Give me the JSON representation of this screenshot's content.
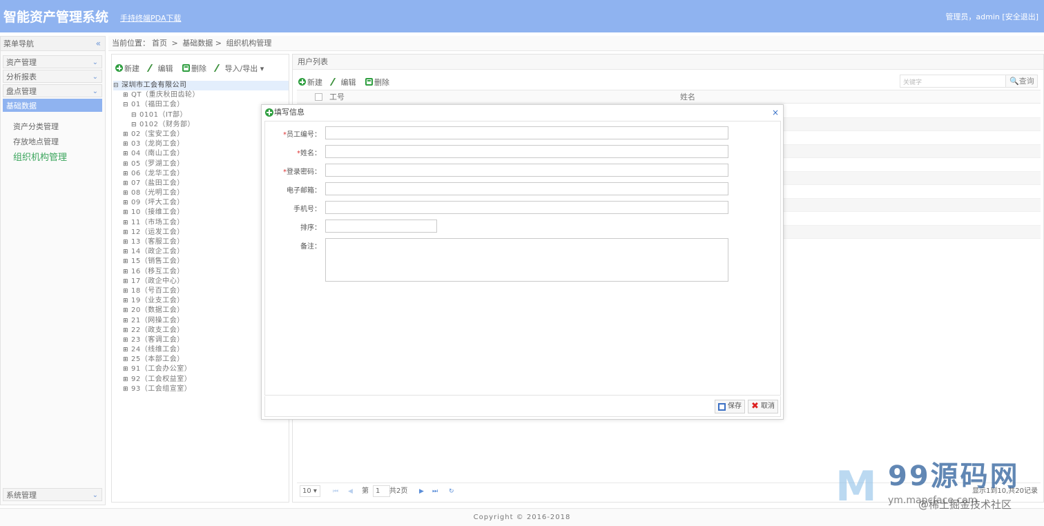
{
  "header": {
    "title": "智能资产管理系统",
    "pda_link": "手持终端PDA下载",
    "user_prefix": "管理员，admin",
    "logout": "[安全退出]"
  },
  "nav": {
    "title": "菜单导航",
    "sections": [
      {
        "label": "资产管理"
      },
      {
        "label": "分析报表"
      },
      {
        "label": "盘点管理"
      },
      {
        "label": "基础数据"
      }
    ],
    "sub_items": [
      "资产分类管理",
      "存放地点管理",
      "组织机构管理"
    ],
    "bottom_section": "系统管理"
  },
  "breadcrumb": {
    "prefix": "当前位置：",
    "home": "首页",
    "level1": "基础数据",
    "level2": "组织机构管理",
    "sep": ">"
  },
  "tree_toolbar": {
    "new": "新建",
    "edit": "编辑",
    "delete": "删除",
    "import_export": "导入/导出"
  },
  "tree": {
    "root": "深圳市工会有限公司",
    "nodes": [
      {
        "toggle": "⊞",
        "label": "QT（重庆秋田齿轮）",
        "indent": 0
      },
      {
        "toggle": "⊟",
        "label": "01（福田工会）",
        "indent": 0
      },
      {
        "toggle": "⊟",
        "label": "0101（IT部）",
        "indent": 1
      },
      {
        "toggle": "⊟",
        "label": "0102（财务部）",
        "indent": 1
      },
      {
        "toggle": "⊞",
        "label": "02（宝安工会）",
        "indent": 0
      },
      {
        "toggle": "⊞",
        "label": "03（龙岗工会）",
        "indent": 0
      },
      {
        "toggle": "⊞",
        "label": "04（南山工会）",
        "indent": 0
      },
      {
        "toggle": "⊞",
        "label": "05（罗湖工会）",
        "indent": 0
      },
      {
        "toggle": "⊞",
        "label": "06（龙华工会）",
        "indent": 0
      },
      {
        "toggle": "⊞",
        "label": "07（盐田工会）",
        "indent": 0
      },
      {
        "toggle": "⊞",
        "label": "08（光明工会）",
        "indent": 0
      },
      {
        "toggle": "⊞",
        "label": "09（坪大工会）",
        "indent": 0
      },
      {
        "toggle": "⊞",
        "label": "10（接维工会）",
        "indent": 0
      },
      {
        "toggle": "⊞",
        "label": "11（市场工会）",
        "indent": 0
      },
      {
        "toggle": "⊞",
        "label": "12（运发工会）",
        "indent": 0
      },
      {
        "toggle": "⊞",
        "label": "13（客服工会）",
        "indent": 0
      },
      {
        "toggle": "⊞",
        "label": "14（政企工会）",
        "indent": 0
      },
      {
        "toggle": "⊞",
        "label": "15（销售工会）",
        "indent": 0
      },
      {
        "toggle": "⊞",
        "label": "16（移互工会）",
        "indent": 0
      },
      {
        "toggle": "⊞",
        "label": "17（政企中心）",
        "indent": 0
      },
      {
        "toggle": "⊞",
        "label": "18（号百工会）",
        "indent": 0
      },
      {
        "toggle": "⊞",
        "label": "19（业支工会）",
        "indent": 0
      },
      {
        "toggle": "⊞",
        "label": "20（数据工会）",
        "indent": 0
      },
      {
        "toggle": "⊞",
        "label": "21（网操工会）",
        "indent": 0
      },
      {
        "toggle": "⊞",
        "label": "22（政支工会）",
        "indent": 0
      },
      {
        "toggle": "⊞",
        "label": "23（客调工会）",
        "indent": 0
      },
      {
        "toggle": "⊞",
        "label": "24（线维工会）",
        "indent": 0
      },
      {
        "toggle": "⊞",
        "label": "25（本部工会）",
        "indent": 0
      },
      {
        "toggle": "⊞",
        "label": "91（工会办公室）",
        "indent": 0
      },
      {
        "toggle": "⊞",
        "label": "92（工会权益室）",
        "indent": 0
      },
      {
        "toggle": "⊞",
        "label": "93（工会组宣室）",
        "indent": 0
      }
    ]
  },
  "user_list": {
    "title": "用户列表",
    "new": "新建",
    "edit": "编辑",
    "delete": "删除",
    "search_placeholder": "关键字",
    "search_button": "查询",
    "col_id": "工号",
    "col_name": "姓名"
  },
  "pager": {
    "page_size": "10 ▾",
    "page_label": "第",
    "page_value": "1",
    "total_pages": "共2页",
    "info": "显示1到10,共20记录"
  },
  "modal": {
    "title": "填写信息",
    "close": "×",
    "fields": {
      "employee_no": {
        "label": "员工编号：",
        "required": "*",
        "value": ""
      },
      "name": {
        "label": "姓名：",
        "required": "*",
        "value": ""
      },
      "password": {
        "label": "登录密码：",
        "required": "*",
        "value": ""
      },
      "email": {
        "label": "电子邮箱：",
        "value": ""
      },
      "phone": {
        "label": "手机号：",
        "value": ""
      },
      "sort": {
        "label": "排序：",
        "value": ""
      },
      "remark": {
        "label": "备注：",
        "value": ""
      }
    },
    "save": "保存",
    "cancel": "取消"
  },
  "footer": {
    "copyright": "Copyright © 2016-2018"
  },
  "watermark": {
    "logo_letter": "M",
    "brand": "99源码网",
    "url": "ym.mapcface.com",
    "credit": "@稀土掘金技术社区"
  },
  "colors": {
    "header_bg": "#8fb3f0",
    "active_nav": "#8fb3f0",
    "current_sub": "#3ba55c",
    "required": "#dd3333"
  }
}
